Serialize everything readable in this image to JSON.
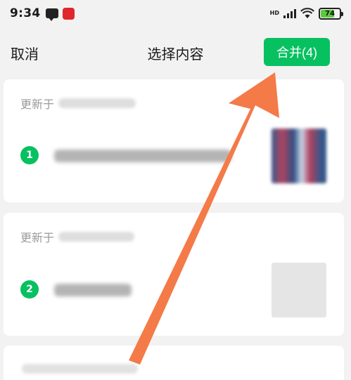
{
  "status_bar": {
    "time": "9:34",
    "network": "HD",
    "battery_level": "74",
    "battery_fraction": 0.74,
    "battery_color": "#5cc93f",
    "icons": [
      "message-icon",
      "app-icon",
      "signal-icon",
      "wifi-icon",
      "battery-icon"
    ]
  },
  "header": {
    "cancel_label": "取消",
    "title": "选择内容",
    "merge_label": "合并(4)"
  },
  "cards": [
    {
      "updated_prefix": "更新于",
      "index": "1"
    },
    {
      "updated_prefix": "更新于",
      "index": "2"
    }
  ],
  "colors": {
    "accent": "#07c160",
    "annotation_arrow": "#f47a48"
  }
}
